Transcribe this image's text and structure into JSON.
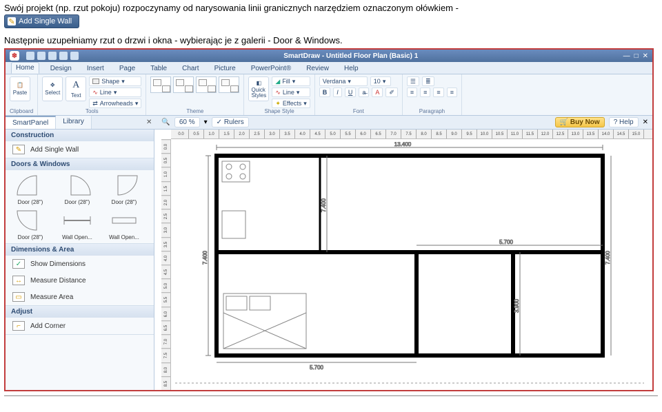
{
  "intro": {
    "part1": "Swój projekt (np. rzut pokoju) rozpoczynamy od narysowania linii granicznych narzędziem oznaczonym ołówkiem -",
    "part2": "Następnie uzupełniamy rzut o drzwi i okna - wybierając je z galerii  - Door & Windows."
  },
  "add_wall_btn": "Add Single Wall",
  "app": {
    "title": "SmartDraw - Untitled Floor Plan (Basic) 1",
    "tabs": [
      "Home",
      "Design",
      "Insert",
      "Page",
      "Table",
      "Chart",
      "Picture",
      "PowerPoint®",
      "Review",
      "Help"
    ],
    "ribbon": {
      "paste": "Paste",
      "clipboard": "Clipboard",
      "select": "Select",
      "text": "Text",
      "shape": "Shape",
      "line": "Line",
      "arrowheads": "Arrowheads",
      "tools": "Tools",
      "theme": "Theme",
      "quick_styles": "Quick\nStyles",
      "fill": "Fill",
      "line2": "Line",
      "effects": "Effects",
      "shape_style": "Shape Style",
      "font_name": "Verdana",
      "font_size": "10",
      "font": "Font",
      "paragraph": "Paragraph"
    },
    "subbar": {
      "smartpanel": "SmartPanel",
      "library": "Library",
      "zoom_val": "60 %",
      "rulers": "Rulers",
      "buy_now": "Buy Now",
      "help": "Help"
    },
    "sidepanel": {
      "construction": "Construction",
      "add_single_wall": "Add Single Wall",
      "doors_windows": "Doors & Windows",
      "door28_a": "Door (28\")",
      "door28_b": "Door (28\")",
      "door28_c": "Door (28\")",
      "door28_d": "Door (28\")",
      "wall_open1": "Wall Open...",
      "wall_open2": "Wall Open...",
      "dimensions_area": "Dimensions & Area",
      "show_dimensions": "Show Dimensions",
      "measure_distance": "Measure Distance",
      "measure_area": "Measure Area",
      "adjust": "Adjust",
      "add_corner": "Add Corner"
    },
    "plan_dims": {
      "top": "13.400",
      "mid_w": "5.700",
      "left_h": "7.400",
      "inner_h": "7.400",
      "bottom_w": "5.700",
      "lower_h": "3.900",
      "right_h": "7.400"
    }
  }
}
